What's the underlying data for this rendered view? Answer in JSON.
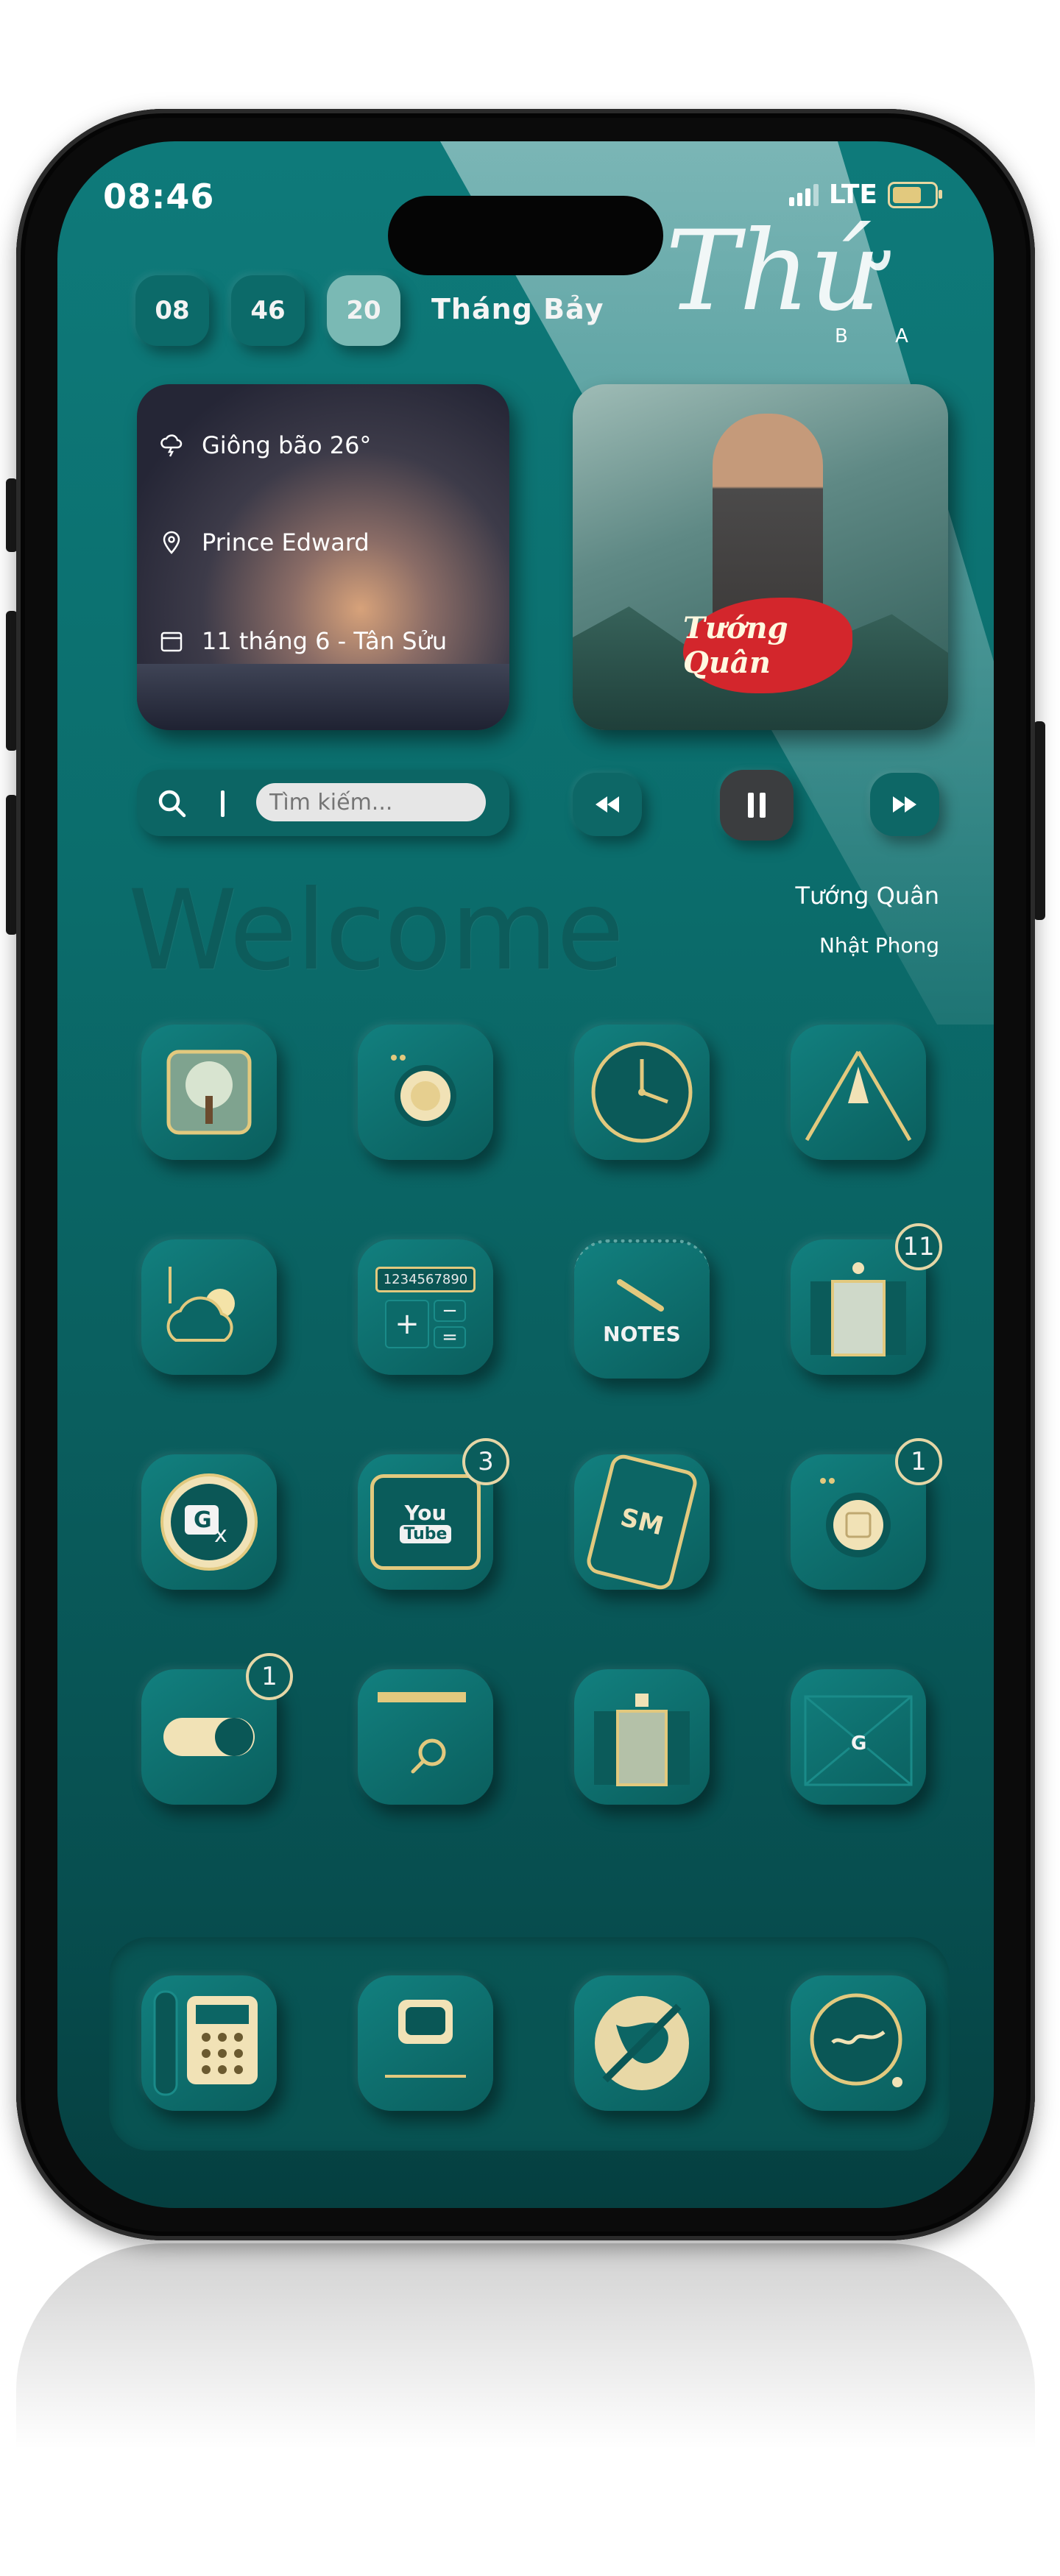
{
  "status": {
    "time": "08:46",
    "network": "LTE"
  },
  "date": {
    "hour": "08",
    "minute": "46",
    "day": "20",
    "month": "Tháng Bảy",
    "weekday": "Thứ",
    "weekday_suffix": "B A"
  },
  "weather": {
    "condition": "Giông bão 26°",
    "location": "Prince Edward",
    "lunar_date": "11 tháng 6 - Tân Sửu"
  },
  "album": {
    "art_title": "Tướng Quân"
  },
  "search": {
    "placeholder": "Tìm kiếm..."
  },
  "player": {
    "song": "Tướng Quân",
    "artist": "Nhật Phong"
  },
  "welcome": "Welcome",
  "apps": {
    "row1": [
      {
        "icon": "tree-icon"
      },
      {
        "icon": "camera-lens-icon"
      },
      {
        "icon": "clock-icon"
      },
      {
        "icon": "maps-road-icon"
      }
    ],
    "row2": [
      {
        "icon": "weather-icon"
      },
      {
        "icon": "calculator-icon",
        "display": "1234567890"
      },
      {
        "icon": "notes-icon",
        "label": "NOTES"
      },
      {
        "icon": "elevator-icon",
        "badge": "11"
      }
    ],
    "row3": [
      {
        "icon": "translate-icon"
      },
      {
        "icon": "youtube-tv-icon",
        "line1": "You",
        "line2": "Tube",
        "badge": "3"
      },
      {
        "icon": "phone-sms-icon",
        "label": "SM"
      },
      {
        "icon": "camera-icon",
        "badge": "1"
      }
    ],
    "row4": [
      {
        "icon": "toggle-settings-icon",
        "badge": "1"
      },
      {
        "icon": "folder-search-icon"
      },
      {
        "icon": "photo-frame-icon"
      },
      {
        "icon": "mail-envelope-icon"
      }
    ],
    "dock": [
      {
        "icon": "telephone-icon"
      },
      {
        "icon": "tv-messages-icon"
      },
      {
        "icon": "globe-browser-icon"
      },
      {
        "icon": "hello-chat-icon"
      }
    ]
  },
  "colors": {
    "background": "#0b6d6c",
    "accent_gold": "#e2c97e",
    "badge_ring": "#e5d6a6"
  }
}
